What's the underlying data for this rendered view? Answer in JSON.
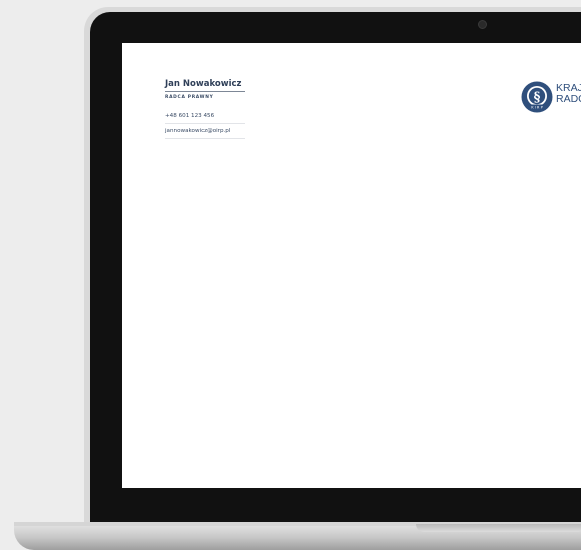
{
  "card": {
    "name": "Jan Nowakowicz",
    "title": "RADCA PRAWNY",
    "phone": "+48 601 123 456",
    "email": "jannowakowicz@oirp.pl"
  },
  "logo": {
    "icon": "kirp-seal-icon",
    "seal_letters": "K I R P",
    "line1": "KRAJO",
    "line2": "RADC"
  },
  "colors": {
    "navy": "#2f3f58",
    "logo_blue": "#2f4f7c",
    "background": "#ededed"
  }
}
